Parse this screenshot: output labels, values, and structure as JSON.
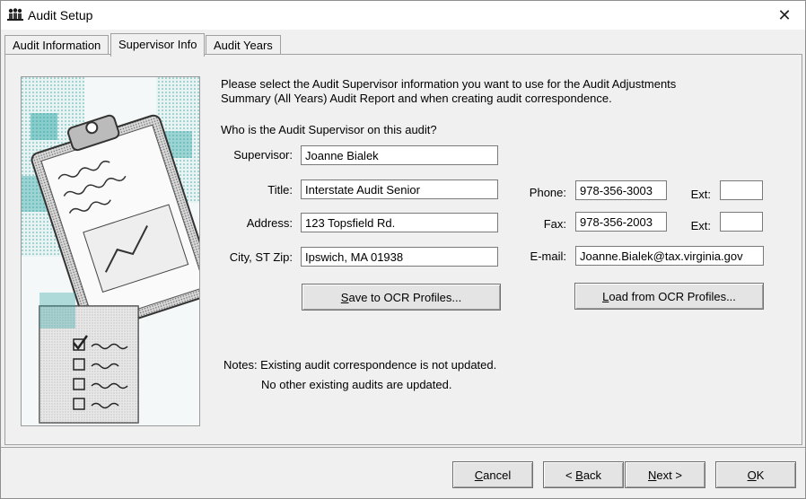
{
  "window": {
    "title": "Audit Setup",
    "close_glyph": "✕"
  },
  "tabs": [
    {
      "label": "Audit Information"
    },
    {
      "label": "Supervisor Info"
    },
    {
      "label": "Audit Years"
    }
  ],
  "intro": {
    "line1": "Please select the Audit Supervisor information you want to use for the Audit Adjustments",
    "line2": "Summary (All Years) Audit Report and when creating audit correspondence."
  },
  "question": "Who is the Audit Supervisor on this audit?",
  "form": {
    "supervisor_label": "Supervisor:",
    "supervisor_value": "Joanne Bialek",
    "title_label": "Title:",
    "title_value": "Interstate Audit Senior",
    "address_label": "Address:",
    "address_value": "123 Topsfield Rd.",
    "city_label": "City, ST Zip:",
    "city_value": "Ipswich, MA 01938",
    "phone_label": "Phone:",
    "phone_value": "978-356-3003",
    "phone_ext_label": "Ext:",
    "phone_ext_value": "",
    "fax_label": "Fax:",
    "fax_value": "978-356-2003",
    "fax_ext_label": "Ext:",
    "fax_ext_value": "",
    "email_label": "E-mail:",
    "email_value": "Joanne.Bialek@tax.virginia.gov"
  },
  "buttons": {
    "save_profiles": {
      "pre": "",
      "key": "S",
      "post": "ave to OCR Profiles..."
    },
    "load_profiles": {
      "pre": "",
      "key": "L",
      "post": "oad from OCR Profiles..."
    }
  },
  "notes": {
    "line1": "Notes: Existing audit correspondence is not updated.",
    "line2": "No other existing audits are updated."
  },
  "footer": {
    "cancel": {
      "pre": "",
      "key": "C",
      "post": "ancel"
    },
    "back": {
      "pre": "< ",
      "key": "B",
      "post": "ack"
    },
    "next": {
      "pre": "",
      "key": "N",
      "post": "ext >"
    },
    "ok": {
      "pre": "",
      "key": "O",
      "post": "K"
    }
  },
  "icons": {
    "app": "people-icon",
    "close": "close-icon",
    "illustration": "clipboard-checklist-image"
  },
  "colors": {
    "accent": "#2aa3a3",
    "window_bg": "#f0f0f0",
    "field_border": "#7a7a7a"
  }
}
